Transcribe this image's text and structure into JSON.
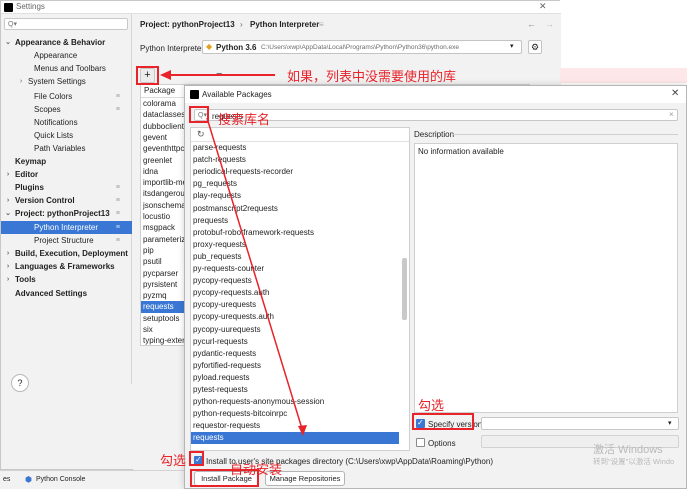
{
  "settings": {
    "title": "Settings",
    "search_placeholder": "Q▾",
    "sidebar": [
      {
        "label": "Appearance & Behavior",
        "bold": true,
        "chevron": "⌄",
        "indent": 0
      },
      {
        "label": "Appearance",
        "indent": 2
      },
      {
        "label": "Menus and Toolbars",
        "indent": 2
      },
      {
        "label": "System Settings",
        "chevron": "›",
        "indent": 1
      },
      {
        "label": "File Colors",
        "indent": 2,
        "pin": true
      },
      {
        "label": "Scopes",
        "indent": 2,
        "pin": true
      },
      {
        "label": "Notifications",
        "indent": 2
      },
      {
        "label": "Quick Lists",
        "indent": 2
      },
      {
        "label": "Path Variables",
        "indent": 2
      },
      {
        "label": "Keymap",
        "bold": true,
        "indent": 0
      },
      {
        "label": "Editor",
        "bold": true,
        "chevron": "›",
        "indent": 0
      },
      {
        "label": "Plugins",
        "bold": true,
        "indent": 0,
        "pin": true
      },
      {
        "label": "Version Control",
        "bold": true,
        "chevron": "›",
        "indent": 0,
        "pin": true
      },
      {
        "label": "Project: pythonProject13",
        "bold": true,
        "chevron": "⌄",
        "indent": 0,
        "pin": true
      },
      {
        "label": "Python Interpreter",
        "indent": 2,
        "pin": true,
        "selected": true
      },
      {
        "label": "Project Structure",
        "indent": 2,
        "pin": true
      },
      {
        "label": "Build, Execution, Deployment",
        "bold": true,
        "chevron": "›",
        "indent": 0
      },
      {
        "label": "Languages & Frameworks",
        "bold": true,
        "chevron": "›",
        "indent": 0
      },
      {
        "label": "Tools",
        "bold": true,
        "chevron": "›",
        "indent": 0
      },
      {
        "label": "Advanced Settings",
        "bold": true,
        "indent": 0
      }
    ],
    "breadcrumb_project": "Project: pythonProject13",
    "breadcrumb_sep": "›",
    "breadcrumb_page": "Python Interpreter",
    "breadcrumb_icon": "≡",
    "nav_back": "←",
    "nav_forward": "→",
    "interpreter_label": "Python Interpreter:",
    "interpreter_name": "Python 3.6",
    "interpreter_path": "C:\\Users\\xwp\\AppData\\Local\\Programs\\Python\\Python36\\python.exe",
    "gear_glyph": "⚙",
    "add_glyph": "+",
    "remove_glyph": "−",
    "packages_header": "Package",
    "packages": [
      "colorama",
      "dataclasses",
      "dubboclient",
      "gevent",
      "geventhttpclient",
      "greenlet",
      "idna",
      "importlib-metadata",
      "itsdangerous",
      "jsonschema",
      "locustio",
      "msgpack",
      "parameterized",
      "pip",
      "psutil",
      "pycparser",
      "pyrsistent",
      "pyzmq",
      "requests",
      "setuptools",
      "six",
      "typing-extensions"
    ],
    "selected_package": "requests",
    "help_glyph": "?",
    "close_glyph": "✕"
  },
  "bottom_bar": {
    "left_text": "es",
    "console_label": "Python Console"
  },
  "dialog": {
    "title": "Available Packages",
    "close_glyph": "✕",
    "search_value": "requests",
    "search_clear": "×",
    "refresh_glyph": "↻",
    "results": [
      "parse-requests",
      "patch-requests",
      "periodical-requests-recorder",
      "pg_requests",
      "play-requests",
      "postmanscript2requests",
      "prequests",
      "protobuf-robotframework-requests",
      "proxy-requests",
      "pub_requests",
      "py-requests-counter",
      "pycopy-requests",
      "pycopy-requests.auth",
      "pycopy-urequests",
      "pycopy-urequests.auth",
      "pycopy-uurequests",
      "pycurl-requests",
      "pydantic-requests",
      "pyfortified-requests",
      "pyload.requests",
      "pytest-requests",
      "python-requests-anonymous-session",
      "python-requests-bitcoinrpc",
      "requestor-requests",
      "requests"
    ],
    "selected_result": "requests",
    "description_label": "Description",
    "description_text": "No information available",
    "specify_version_label": "Specify version",
    "specify_version_checked": true,
    "options_label": "Options",
    "options_checked": false,
    "install_user_label": "Install to user's site packages directory (C:\\Users\\xwp\\AppData\\Roaming\\Python)",
    "install_user_checked": true,
    "install_button": "Install Package",
    "manage_button": "Manage Repositories"
  },
  "annotations": {
    "add_note": "如果，列表中没需要使用的库",
    "search_note": "搜索库名",
    "check_version_note": "勾选",
    "check_user_note": "勾选",
    "auto_install_note": "自动安装",
    "color": "#e8232a"
  },
  "watermark": {
    "line1": "激活 Windows",
    "line2": "转到\"设置\"以激活 Windo"
  }
}
